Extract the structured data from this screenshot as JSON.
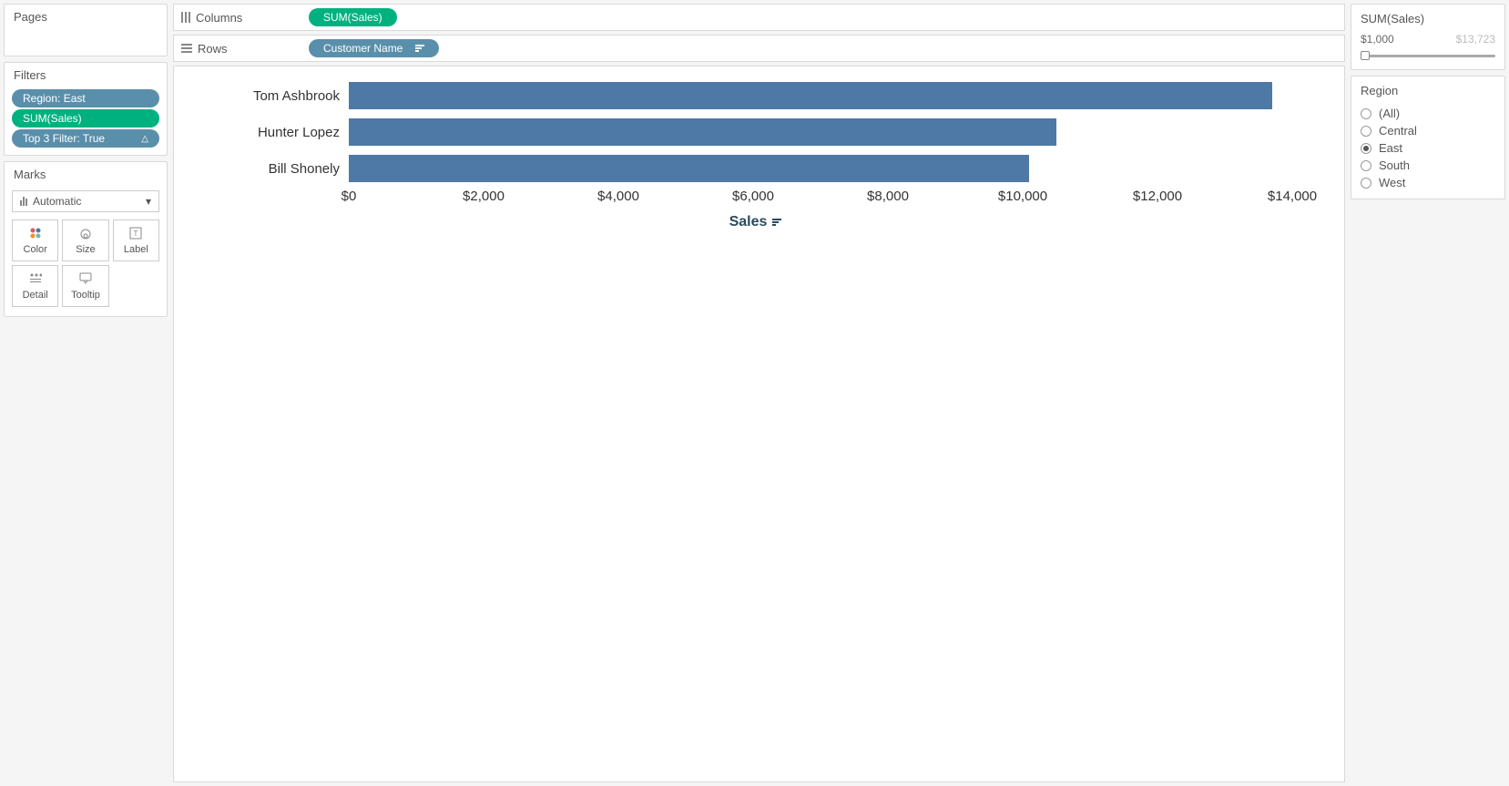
{
  "pages": {
    "title": "Pages"
  },
  "filters": {
    "title": "Filters",
    "items": [
      {
        "label": "Region: East",
        "color": "blue"
      },
      {
        "label": "SUM(Sales)",
        "color": "green"
      },
      {
        "label": "Top 3 Filter: True",
        "color": "blue",
        "indicator": "△"
      }
    ]
  },
  "marks": {
    "title": "Marks",
    "type": "Automatic",
    "buttons": [
      "Color",
      "Size",
      "Label",
      "Detail",
      "Tooltip"
    ]
  },
  "shelves": {
    "columns": {
      "label": "Columns",
      "pill": "SUM(Sales)"
    },
    "rows": {
      "label": "Rows",
      "pill": "Customer Name"
    }
  },
  "chart_data": {
    "type": "bar",
    "categories": [
      "Tom Ashbrook",
      "Hunter Lopez",
      "Bill Shonely"
    ],
    "values": [
      13700,
      10500,
      10100
    ],
    "xlabel": "Sales",
    "ylabel": "",
    "xlim": [
      0,
      14500
    ],
    "ticks": [
      {
        "pos": 0,
        "label": "$0"
      },
      {
        "pos": 2000,
        "label": "$2,000"
      },
      {
        "pos": 4000,
        "label": "$4,000"
      },
      {
        "pos": 6000,
        "label": "$6,000"
      },
      {
        "pos": 8000,
        "label": "$8,000"
      },
      {
        "pos": 10000,
        "label": "$10,000"
      },
      {
        "pos": 12000,
        "label": "$12,000"
      },
      {
        "pos": 14000,
        "label": "$14,000"
      }
    ]
  },
  "right": {
    "sum_filter": {
      "title": "SUM(Sales)",
      "min": "$1,000",
      "max": "$13,723"
    },
    "region_filter": {
      "title": "Region",
      "options": [
        {
          "label": "(All)",
          "checked": false
        },
        {
          "label": "Central",
          "checked": false
        },
        {
          "label": "East",
          "checked": true
        },
        {
          "label": "South",
          "checked": false
        },
        {
          "label": "West",
          "checked": false
        }
      ]
    }
  }
}
